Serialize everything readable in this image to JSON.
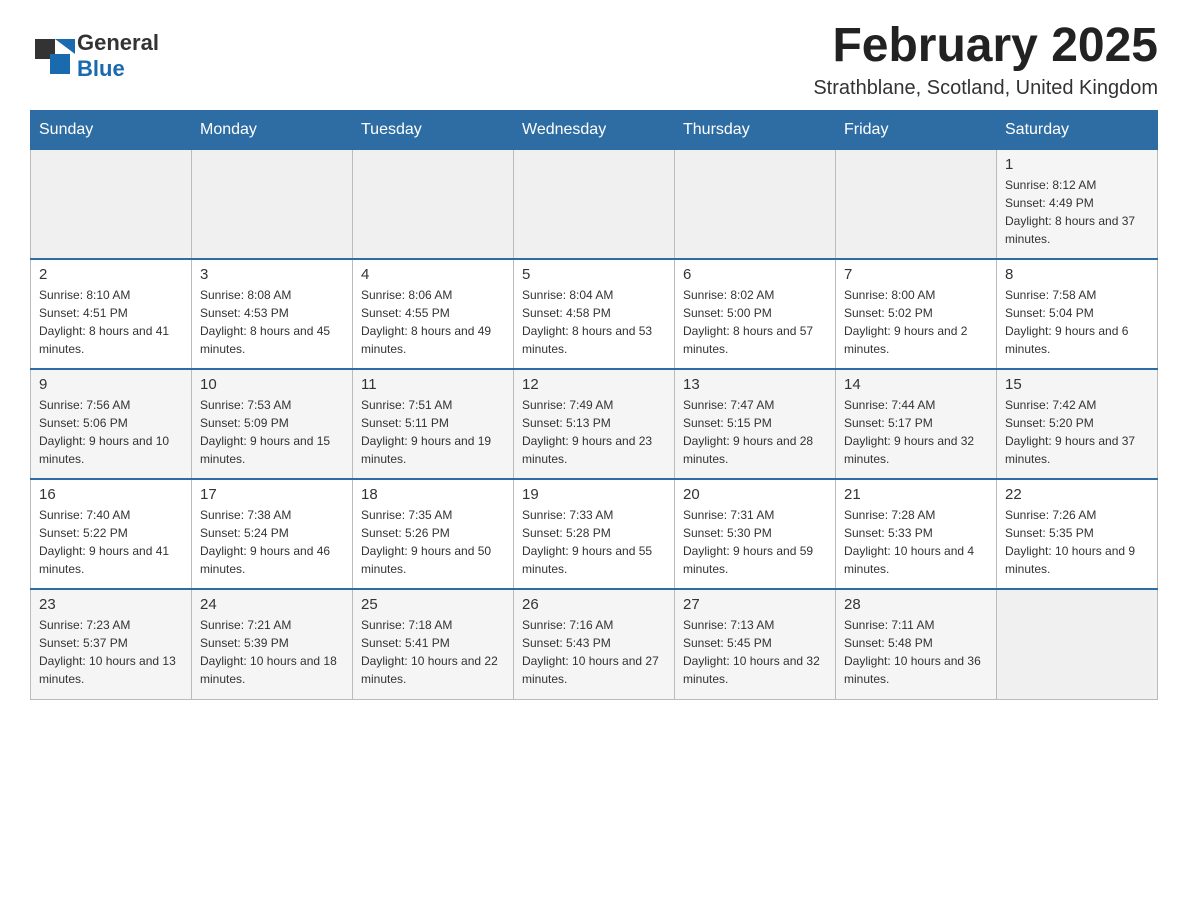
{
  "header": {
    "logo_text_general": "General",
    "logo_text_blue": "Blue",
    "title": "February 2025",
    "subtitle": "Strathblane, Scotland, United Kingdom"
  },
  "calendar": {
    "days_of_week": [
      "Sunday",
      "Monday",
      "Tuesday",
      "Wednesday",
      "Thursday",
      "Friday",
      "Saturday"
    ],
    "weeks": [
      [
        {
          "day": "",
          "info": ""
        },
        {
          "day": "",
          "info": ""
        },
        {
          "day": "",
          "info": ""
        },
        {
          "day": "",
          "info": ""
        },
        {
          "day": "",
          "info": ""
        },
        {
          "day": "",
          "info": ""
        },
        {
          "day": "1",
          "info": "Sunrise: 8:12 AM\nSunset: 4:49 PM\nDaylight: 8 hours and 37 minutes."
        }
      ],
      [
        {
          "day": "2",
          "info": "Sunrise: 8:10 AM\nSunset: 4:51 PM\nDaylight: 8 hours and 41 minutes."
        },
        {
          "day": "3",
          "info": "Sunrise: 8:08 AM\nSunset: 4:53 PM\nDaylight: 8 hours and 45 minutes."
        },
        {
          "day": "4",
          "info": "Sunrise: 8:06 AM\nSunset: 4:55 PM\nDaylight: 8 hours and 49 minutes."
        },
        {
          "day": "5",
          "info": "Sunrise: 8:04 AM\nSunset: 4:58 PM\nDaylight: 8 hours and 53 minutes."
        },
        {
          "day": "6",
          "info": "Sunrise: 8:02 AM\nSunset: 5:00 PM\nDaylight: 8 hours and 57 minutes."
        },
        {
          "day": "7",
          "info": "Sunrise: 8:00 AM\nSunset: 5:02 PM\nDaylight: 9 hours and 2 minutes."
        },
        {
          "day": "8",
          "info": "Sunrise: 7:58 AM\nSunset: 5:04 PM\nDaylight: 9 hours and 6 minutes."
        }
      ],
      [
        {
          "day": "9",
          "info": "Sunrise: 7:56 AM\nSunset: 5:06 PM\nDaylight: 9 hours and 10 minutes."
        },
        {
          "day": "10",
          "info": "Sunrise: 7:53 AM\nSunset: 5:09 PM\nDaylight: 9 hours and 15 minutes."
        },
        {
          "day": "11",
          "info": "Sunrise: 7:51 AM\nSunset: 5:11 PM\nDaylight: 9 hours and 19 minutes."
        },
        {
          "day": "12",
          "info": "Sunrise: 7:49 AM\nSunset: 5:13 PM\nDaylight: 9 hours and 23 minutes."
        },
        {
          "day": "13",
          "info": "Sunrise: 7:47 AM\nSunset: 5:15 PM\nDaylight: 9 hours and 28 minutes."
        },
        {
          "day": "14",
          "info": "Sunrise: 7:44 AM\nSunset: 5:17 PM\nDaylight: 9 hours and 32 minutes."
        },
        {
          "day": "15",
          "info": "Sunrise: 7:42 AM\nSunset: 5:20 PM\nDaylight: 9 hours and 37 minutes."
        }
      ],
      [
        {
          "day": "16",
          "info": "Sunrise: 7:40 AM\nSunset: 5:22 PM\nDaylight: 9 hours and 41 minutes."
        },
        {
          "day": "17",
          "info": "Sunrise: 7:38 AM\nSunset: 5:24 PM\nDaylight: 9 hours and 46 minutes."
        },
        {
          "day": "18",
          "info": "Sunrise: 7:35 AM\nSunset: 5:26 PM\nDaylight: 9 hours and 50 minutes."
        },
        {
          "day": "19",
          "info": "Sunrise: 7:33 AM\nSunset: 5:28 PM\nDaylight: 9 hours and 55 minutes."
        },
        {
          "day": "20",
          "info": "Sunrise: 7:31 AM\nSunset: 5:30 PM\nDaylight: 9 hours and 59 minutes."
        },
        {
          "day": "21",
          "info": "Sunrise: 7:28 AM\nSunset: 5:33 PM\nDaylight: 10 hours and 4 minutes."
        },
        {
          "day": "22",
          "info": "Sunrise: 7:26 AM\nSunset: 5:35 PM\nDaylight: 10 hours and 9 minutes."
        }
      ],
      [
        {
          "day": "23",
          "info": "Sunrise: 7:23 AM\nSunset: 5:37 PM\nDaylight: 10 hours and 13 minutes."
        },
        {
          "day": "24",
          "info": "Sunrise: 7:21 AM\nSunset: 5:39 PM\nDaylight: 10 hours and 18 minutes."
        },
        {
          "day": "25",
          "info": "Sunrise: 7:18 AM\nSunset: 5:41 PM\nDaylight: 10 hours and 22 minutes."
        },
        {
          "day": "26",
          "info": "Sunrise: 7:16 AM\nSunset: 5:43 PM\nDaylight: 10 hours and 27 minutes."
        },
        {
          "day": "27",
          "info": "Sunrise: 7:13 AM\nSunset: 5:45 PM\nDaylight: 10 hours and 32 minutes."
        },
        {
          "day": "28",
          "info": "Sunrise: 7:11 AM\nSunset: 5:48 PM\nDaylight: 10 hours and 36 minutes."
        },
        {
          "day": "",
          "info": ""
        }
      ]
    ]
  }
}
